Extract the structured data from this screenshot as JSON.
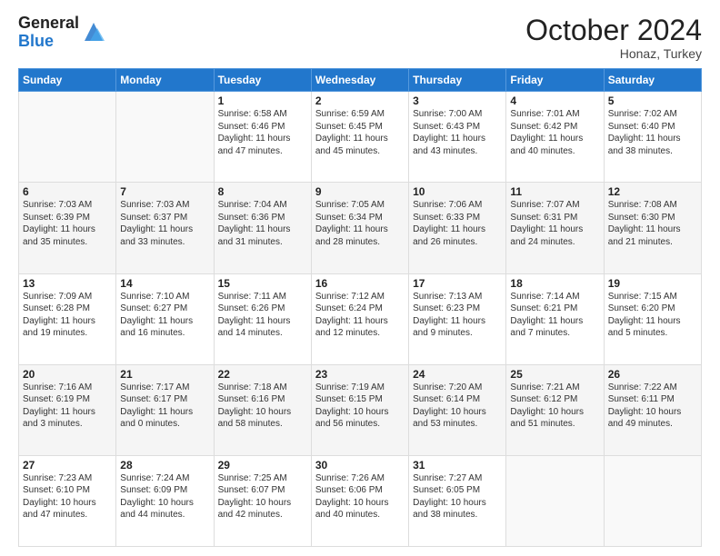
{
  "header": {
    "logo_general": "General",
    "logo_blue": "Blue",
    "month_title": "October 2024",
    "location": "Honaz, Turkey"
  },
  "weekdays": [
    "Sunday",
    "Monday",
    "Tuesday",
    "Wednesday",
    "Thursday",
    "Friday",
    "Saturday"
  ],
  "weeks": [
    [
      {
        "day": "",
        "sunrise": "",
        "sunset": "",
        "daylight": ""
      },
      {
        "day": "",
        "sunrise": "",
        "sunset": "",
        "daylight": ""
      },
      {
        "day": "1",
        "sunrise": "Sunrise: 6:58 AM",
        "sunset": "Sunset: 6:46 PM",
        "daylight": "Daylight: 11 hours and 47 minutes."
      },
      {
        "day": "2",
        "sunrise": "Sunrise: 6:59 AM",
        "sunset": "Sunset: 6:45 PM",
        "daylight": "Daylight: 11 hours and 45 minutes."
      },
      {
        "day": "3",
        "sunrise": "Sunrise: 7:00 AM",
        "sunset": "Sunset: 6:43 PM",
        "daylight": "Daylight: 11 hours and 43 minutes."
      },
      {
        "day": "4",
        "sunrise": "Sunrise: 7:01 AM",
        "sunset": "Sunset: 6:42 PM",
        "daylight": "Daylight: 11 hours and 40 minutes."
      },
      {
        "day": "5",
        "sunrise": "Sunrise: 7:02 AM",
        "sunset": "Sunset: 6:40 PM",
        "daylight": "Daylight: 11 hours and 38 minutes."
      }
    ],
    [
      {
        "day": "6",
        "sunrise": "Sunrise: 7:03 AM",
        "sunset": "Sunset: 6:39 PM",
        "daylight": "Daylight: 11 hours and 35 minutes."
      },
      {
        "day": "7",
        "sunrise": "Sunrise: 7:03 AM",
        "sunset": "Sunset: 6:37 PM",
        "daylight": "Daylight: 11 hours and 33 minutes."
      },
      {
        "day": "8",
        "sunrise": "Sunrise: 7:04 AM",
        "sunset": "Sunset: 6:36 PM",
        "daylight": "Daylight: 11 hours and 31 minutes."
      },
      {
        "day": "9",
        "sunrise": "Sunrise: 7:05 AM",
        "sunset": "Sunset: 6:34 PM",
        "daylight": "Daylight: 11 hours and 28 minutes."
      },
      {
        "day": "10",
        "sunrise": "Sunrise: 7:06 AM",
        "sunset": "Sunset: 6:33 PM",
        "daylight": "Daylight: 11 hours and 26 minutes."
      },
      {
        "day": "11",
        "sunrise": "Sunrise: 7:07 AM",
        "sunset": "Sunset: 6:31 PM",
        "daylight": "Daylight: 11 hours and 24 minutes."
      },
      {
        "day": "12",
        "sunrise": "Sunrise: 7:08 AM",
        "sunset": "Sunset: 6:30 PM",
        "daylight": "Daylight: 11 hours and 21 minutes."
      }
    ],
    [
      {
        "day": "13",
        "sunrise": "Sunrise: 7:09 AM",
        "sunset": "Sunset: 6:28 PM",
        "daylight": "Daylight: 11 hours and 19 minutes."
      },
      {
        "day": "14",
        "sunrise": "Sunrise: 7:10 AM",
        "sunset": "Sunset: 6:27 PM",
        "daylight": "Daylight: 11 hours and 16 minutes."
      },
      {
        "day": "15",
        "sunrise": "Sunrise: 7:11 AM",
        "sunset": "Sunset: 6:26 PM",
        "daylight": "Daylight: 11 hours and 14 minutes."
      },
      {
        "day": "16",
        "sunrise": "Sunrise: 7:12 AM",
        "sunset": "Sunset: 6:24 PM",
        "daylight": "Daylight: 11 hours and 12 minutes."
      },
      {
        "day": "17",
        "sunrise": "Sunrise: 7:13 AM",
        "sunset": "Sunset: 6:23 PM",
        "daylight": "Daylight: 11 hours and 9 minutes."
      },
      {
        "day": "18",
        "sunrise": "Sunrise: 7:14 AM",
        "sunset": "Sunset: 6:21 PM",
        "daylight": "Daylight: 11 hours and 7 minutes."
      },
      {
        "day": "19",
        "sunrise": "Sunrise: 7:15 AM",
        "sunset": "Sunset: 6:20 PM",
        "daylight": "Daylight: 11 hours and 5 minutes."
      }
    ],
    [
      {
        "day": "20",
        "sunrise": "Sunrise: 7:16 AM",
        "sunset": "Sunset: 6:19 PM",
        "daylight": "Daylight: 11 hours and 3 minutes."
      },
      {
        "day": "21",
        "sunrise": "Sunrise: 7:17 AM",
        "sunset": "Sunset: 6:17 PM",
        "daylight": "Daylight: 11 hours and 0 minutes."
      },
      {
        "day": "22",
        "sunrise": "Sunrise: 7:18 AM",
        "sunset": "Sunset: 6:16 PM",
        "daylight": "Daylight: 10 hours and 58 minutes."
      },
      {
        "day": "23",
        "sunrise": "Sunrise: 7:19 AM",
        "sunset": "Sunset: 6:15 PM",
        "daylight": "Daylight: 10 hours and 56 minutes."
      },
      {
        "day": "24",
        "sunrise": "Sunrise: 7:20 AM",
        "sunset": "Sunset: 6:14 PM",
        "daylight": "Daylight: 10 hours and 53 minutes."
      },
      {
        "day": "25",
        "sunrise": "Sunrise: 7:21 AM",
        "sunset": "Sunset: 6:12 PM",
        "daylight": "Daylight: 10 hours and 51 minutes."
      },
      {
        "day": "26",
        "sunrise": "Sunrise: 7:22 AM",
        "sunset": "Sunset: 6:11 PM",
        "daylight": "Daylight: 10 hours and 49 minutes."
      }
    ],
    [
      {
        "day": "27",
        "sunrise": "Sunrise: 7:23 AM",
        "sunset": "Sunset: 6:10 PM",
        "daylight": "Daylight: 10 hours and 47 minutes."
      },
      {
        "day": "28",
        "sunrise": "Sunrise: 7:24 AM",
        "sunset": "Sunset: 6:09 PM",
        "daylight": "Daylight: 10 hours and 44 minutes."
      },
      {
        "day": "29",
        "sunrise": "Sunrise: 7:25 AM",
        "sunset": "Sunset: 6:07 PM",
        "daylight": "Daylight: 10 hours and 42 minutes."
      },
      {
        "day": "30",
        "sunrise": "Sunrise: 7:26 AM",
        "sunset": "Sunset: 6:06 PM",
        "daylight": "Daylight: 10 hours and 40 minutes."
      },
      {
        "day": "31",
        "sunrise": "Sunrise: 7:27 AM",
        "sunset": "Sunset: 6:05 PM",
        "daylight": "Daylight: 10 hours and 38 minutes."
      },
      {
        "day": "",
        "sunrise": "",
        "sunset": "",
        "daylight": ""
      },
      {
        "day": "",
        "sunrise": "",
        "sunset": "",
        "daylight": ""
      }
    ]
  ]
}
